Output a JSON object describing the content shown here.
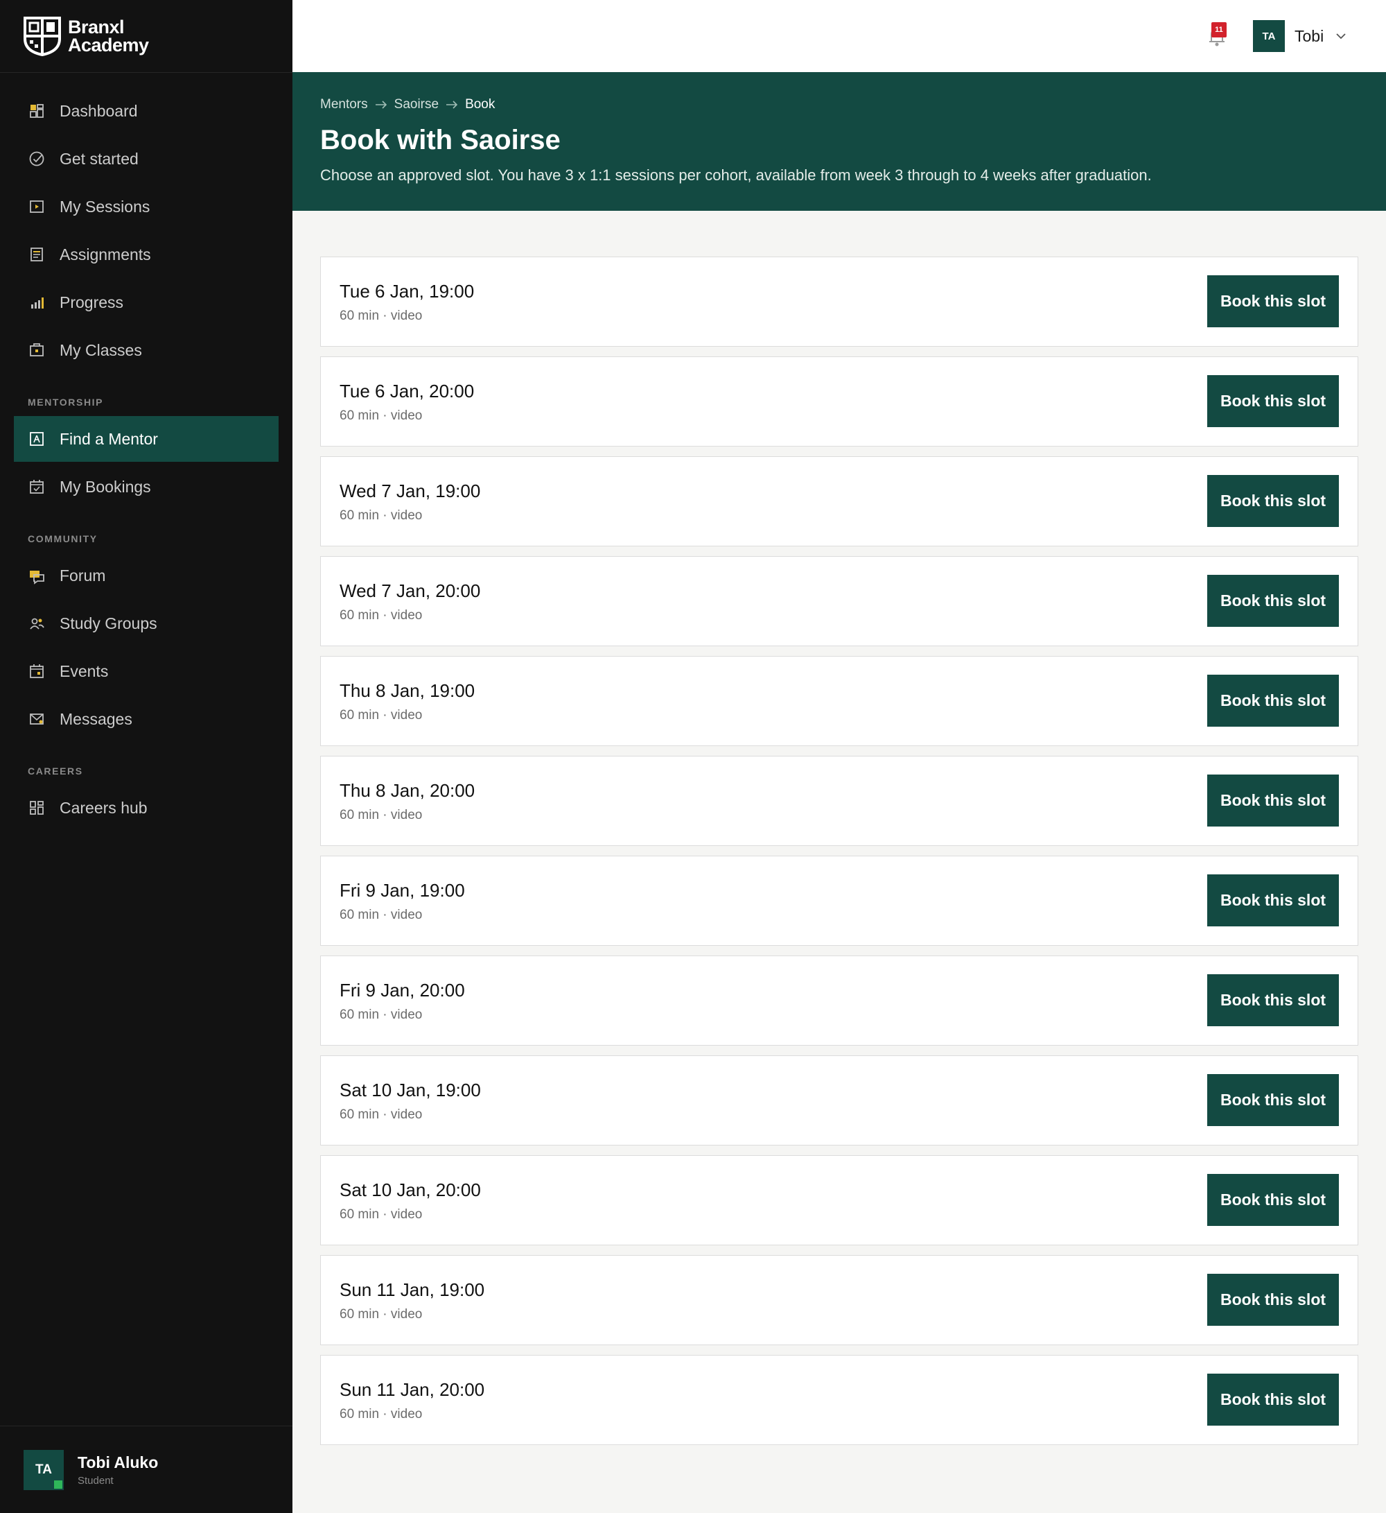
{
  "brand": {
    "line1": "Branxl",
    "line2": "Academy"
  },
  "sidebar": {
    "main": [
      {
        "label": "Dashboard",
        "icon": "dashboard-icon"
      },
      {
        "label": "Get started",
        "icon": "check-circle-icon"
      },
      {
        "label": "My Sessions",
        "icon": "play-icon"
      },
      {
        "label": "Assignments",
        "icon": "document-icon"
      },
      {
        "label": "Progress",
        "icon": "bar-chart-icon"
      },
      {
        "label": "My Classes",
        "icon": "classroom-icon"
      }
    ],
    "mentorship_label": "MENTORSHIP",
    "mentorship": [
      {
        "label": "Find a Mentor",
        "icon": "mentor-icon",
        "active": true
      },
      {
        "label": "My Bookings",
        "icon": "calendar-check-icon"
      }
    ],
    "community_label": "COMMUNITY",
    "community": [
      {
        "label": "Forum",
        "icon": "chat-icon"
      },
      {
        "label": "Study Groups",
        "icon": "group-icon"
      },
      {
        "label": "Events",
        "icon": "calendar-icon"
      },
      {
        "label": "Messages",
        "icon": "mail-icon"
      }
    ],
    "careers_label": "CAREERS",
    "careers": [
      {
        "label": "Careers hub",
        "icon": "grid-icon"
      }
    ],
    "user": {
      "initials": "TA",
      "name": "Tobi Aluko",
      "role": "Student"
    }
  },
  "topbar": {
    "notifications_count": "11",
    "user_initials": "TA",
    "user_name": "Tobi"
  },
  "breadcrumb": [
    "Mentors",
    "Saoirse",
    "Book"
  ],
  "page": {
    "title": "Book with Saoirse",
    "subtitle": "Choose an approved slot. You have 3 x 1:1 sessions per cohort, available from week 3 through to 4 weeks after graduation."
  },
  "slots": [
    {
      "time": "Tue 6 Jan, 19:00",
      "meta": "60 min · video",
      "button": "Book this slot"
    },
    {
      "time": "Tue 6 Jan, 20:00",
      "meta": "60 min · video",
      "button": "Book this slot"
    },
    {
      "time": "Wed 7 Jan, 19:00",
      "meta": "60 min · video",
      "button": "Book this slot"
    },
    {
      "time": "Wed 7 Jan, 20:00",
      "meta": "60 min · video",
      "button": "Book this slot"
    },
    {
      "time": "Thu 8 Jan, 19:00",
      "meta": "60 min · video",
      "button": "Book this slot"
    },
    {
      "time": "Thu 8 Jan, 20:00",
      "meta": "60 min · video",
      "button": "Book this slot"
    },
    {
      "time": "Fri 9 Jan, 19:00",
      "meta": "60 min · video",
      "button": "Book this slot"
    },
    {
      "time": "Fri 9 Jan, 20:00",
      "meta": "60 min · video",
      "button": "Book this slot"
    },
    {
      "time": "Sat 10 Jan, 19:00",
      "meta": "60 min · video",
      "button": "Book this slot"
    },
    {
      "time": "Sat 10 Jan, 20:00",
      "meta": "60 min · video",
      "button": "Book this slot"
    },
    {
      "time": "Sun 11 Jan, 19:00",
      "meta": "60 min · video",
      "button": "Book this slot"
    },
    {
      "time": "Sun 11 Jan, 20:00",
      "meta": "60 min · video",
      "button": "Book this slot"
    }
  ],
  "colors": {
    "primary": "#134a42",
    "sidebar_bg": "#121212",
    "accent_yellow": "#e3b935",
    "badge": "#d2222c"
  }
}
